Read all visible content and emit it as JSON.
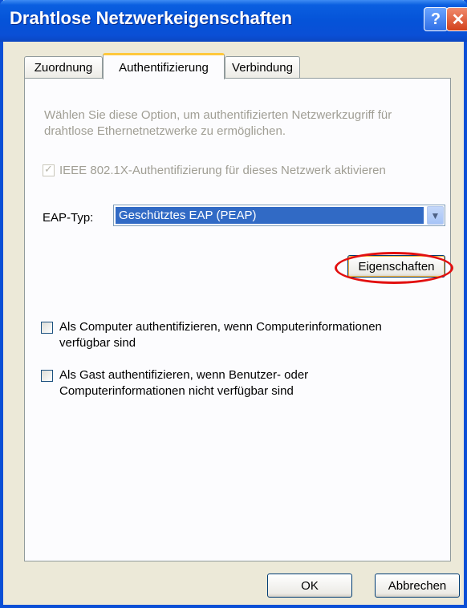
{
  "window": {
    "title": "Drahtlose Netzwerkeigenschaften",
    "help_label": "?",
    "close_label": "✕"
  },
  "tabs": [
    {
      "label": "Zuordnung",
      "active": false
    },
    {
      "label": "Authentifizierung",
      "active": true
    },
    {
      "label": "Verbindung",
      "active": false
    }
  ],
  "auth": {
    "description": "Wählen Sie diese Option, um authentifizierten Netzwerkzugriff für drahtlose Ethernetnetzwerke zu ermöglichen.",
    "ieee_label": "IEEE 802.1X-Authentifizierung für dieses Netzwerk aktivieren",
    "ieee_checked": true,
    "eap_label": "EAP-Typ:",
    "eap_value": "Geschütztes EAP (PEAP)",
    "properties_label": "Eigenschaften",
    "computer_auth_label": "Als Computer authentifizieren, wenn Computerinformationen verfügbar sind",
    "computer_auth_checked": false,
    "guest_auth_label": "Als Gast authentifizieren, wenn Benutzer- oder Computerinformationen nicht verfügbar sind",
    "guest_auth_checked": false
  },
  "footer": {
    "ok_label": "OK",
    "cancel_label": "Abbrechen"
  },
  "colors": {
    "titlebar": "#0a4fd6",
    "selection": "#316ac5",
    "highlight_ring": "#e21010",
    "active_tab_accent": "#ffc83c"
  }
}
